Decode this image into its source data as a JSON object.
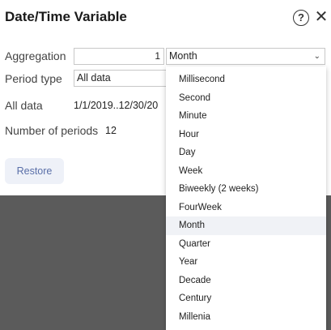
{
  "dialog": {
    "title": "Date/Time Variable",
    "help_icon": "question-circle-icon",
    "close_icon": "close-icon",
    "help_glyph": "?",
    "close_glyph": "✕"
  },
  "fields": {
    "aggregation_label": "Aggregation",
    "aggregation_count": "1",
    "aggregation_unit": "Month",
    "period_type_label": "Period type",
    "period_type_value": "All data",
    "all_data_label": "All data",
    "all_data_value": "1/1/2019..12/30/20",
    "num_periods_label": "Number of periods",
    "num_periods_value": "12"
  },
  "buttons": {
    "restore": "Restore"
  },
  "dropdown": {
    "items": [
      "Millisecond",
      "Second",
      "Minute",
      "Hour",
      "Day",
      "Week",
      "Biweekly (2 weeks)",
      "FourWeek",
      "Month",
      "Quarter",
      "Year",
      "Decade",
      "Century",
      "Millenia"
    ],
    "selected": "Month"
  },
  "colors": {
    "backdrop": "#5b5b5b",
    "restore_bg": "#eef1f8",
    "restore_text": "#5a6fa8",
    "selected_bg": "#f0f2f6"
  }
}
